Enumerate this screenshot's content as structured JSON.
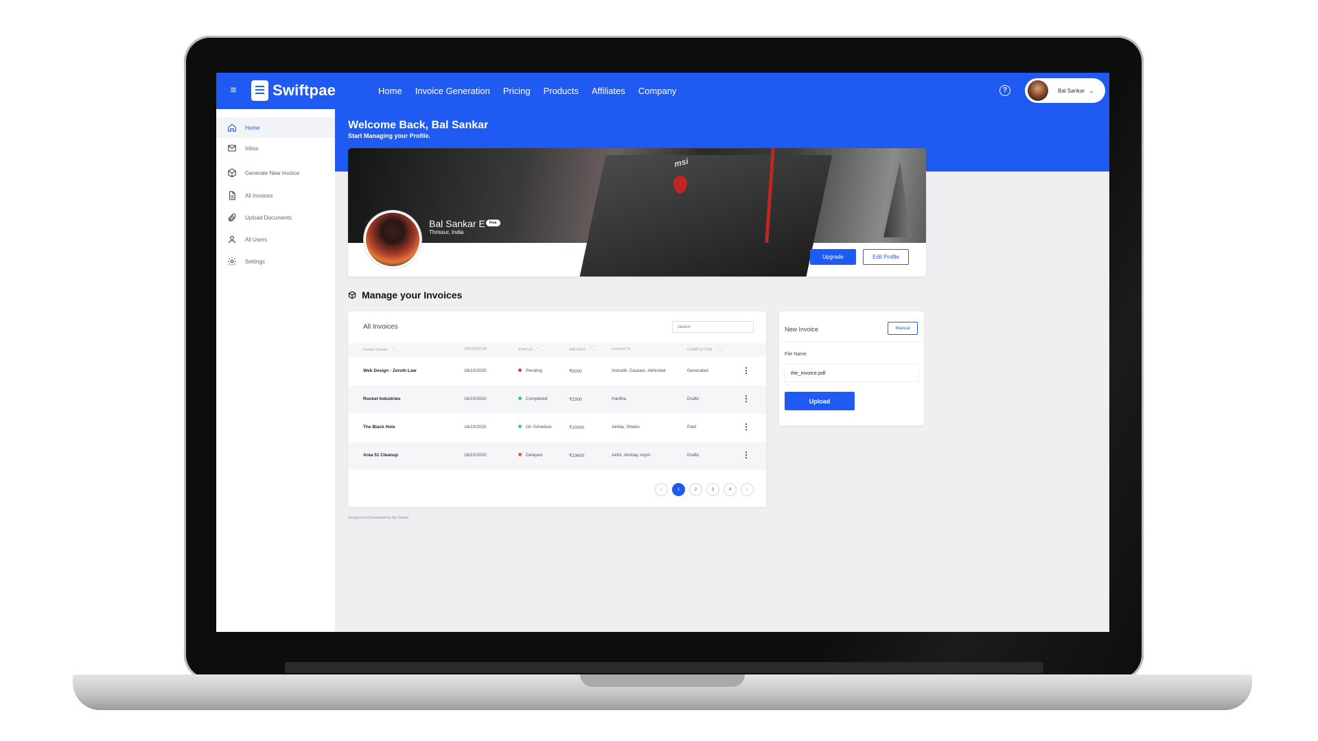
{
  "app": {
    "brand": "Swiftpae",
    "menu_glyph": "≡",
    "nav": [
      "Home",
      "Invoice Generation",
      "Pricing",
      "Products",
      "Affiliates",
      "Company"
    ],
    "help_glyph": "?",
    "user": {
      "name": "Bal Sankar",
      "caret": "⌄"
    }
  },
  "sidebar": {
    "items": [
      {
        "label": "Home",
        "icon": "home-icon",
        "active": true
      },
      {
        "label": "Inbox",
        "icon": "mail-icon"
      },
      {
        "label": "Generate New Invoice",
        "icon": "box-icon"
      },
      {
        "label": "All Invoices",
        "icon": "document-icon"
      },
      {
        "label": "Upload Documents",
        "icon": "paperclip-icon"
      },
      {
        "label": "All Users",
        "icon": "user-icon"
      },
      {
        "label": "Settings",
        "icon": "gear-icon"
      }
    ]
  },
  "hero": {
    "welcome": "Welcome Back, Bal Sankar",
    "subtitle": "Start Managing your Profile."
  },
  "profile": {
    "name": "Bal Sankar E",
    "plan_badge": "Free",
    "location": "Thrissur, India",
    "cover_brand": "msi",
    "upgrade_label": "Upgrade",
    "edit_label": "Edit Profile"
  },
  "invoices": {
    "section_title": "Manage your Invoices",
    "card_title": "All Invoices",
    "search_placeholder": "Search",
    "columns": [
      "Invoice Details",
      "CREATED AT",
      "STATUS",
      "AMOUNT",
      "Invoiced To",
      "COMPLETION"
    ],
    "sort_glyph": "⌃⌄",
    "kebab_glyph": "⋮",
    "rows": [
      {
        "details": "Web Design - Zeroth Law",
        "created": "16/10/2020",
        "status": "Pending",
        "status_color": "#e53935",
        "amount": "₹5000",
        "invoiced_to": "Anirudh, Gautam, Abhishek",
        "completion": "Generated"
      },
      {
        "details": "Rocket Industries",
        "created": "16/10/2020",
        "status": "Completed",
        "status_color": "#2ecc71",
        "amount": "₹2300",
        "invoiced_to": "Haritha",
        "completion": "Drafts"
      },
      {
        "details": "The Black Hole",
        "created": "16/10/2020",
        "status": "On Schedule",
        "status_color": "#1ec8e8",
        "amount": "₹10000",
        "invoiced_to": "Akhila, Shalini",
        "completion": "Paid"
      },
      {
        "details": "Area 51 Cleanup",
        "created": "16/10/2020",
        "status": "Delayed",
        "status_color": "#e8583a",
        "amount": "₹23600",
        "invoiced_to": "Akhil, Akshay, Arjun",
        "completion": "Drafts"
      }
    ],
    "pagination": {
      "prev": "‹",
      "next": "›",
      "pages": [
        "1",
        "2",
        "3",
        "4"
      ],
      "current": "1"
    }
  },
  "new_invoice": {
    "title": "New Invoice",
    "manual_label": "Manual",
    "file_label": "File Name",
    "file_value": "the_invoice.pdf",
    "upload_label": "Upload"
  },
  "footer": {
    "credit": "Designed and Developed by Bal Sankar"
  },
  "colors": {
    "primary": "#1f5bf2",
    "background": "#efeff1"
  }
}
